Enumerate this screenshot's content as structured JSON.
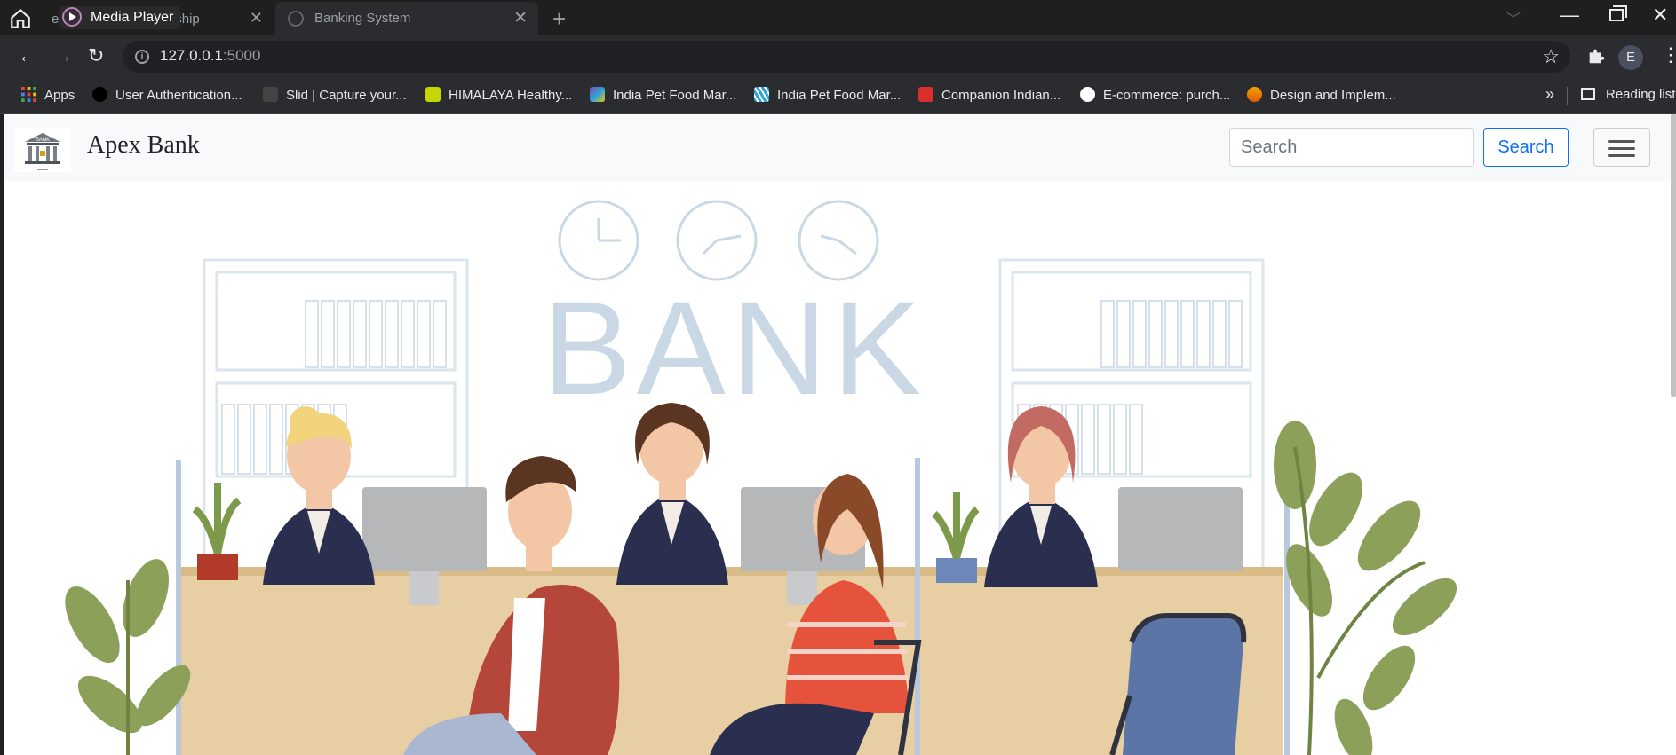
{
  "browser": {
    "tabs": [
      {
        "title": "Media Player",
        "background_title": "e...Tera.. SCP_internship",
        "close": "✕"
      },
      {
        "title": "Banking System",
        "close": "✕"
      }
    ],
    "new_tab": "+",
    "url_host": "127.0.0.1",
    "url_port": ":5000",
    "profile_initial": "E"
  },
  "bookmarks": [
    {
      "label": "Apps",
      "icon_color": "#ea4335"
    },
    {
      "label": "User Authentication...",
      "icon_color": "#000000"
    },
    {
      "label": "Slid | Capture your...",
      "icon_color": "#444444"
    },
    {
      "label": "HIMALAYA Healthy...",
      "icon_color": "#c6d600"
    },
    {
      "label": "India Pet Food Mar...",
      "icon_color": "#8e44ad"
    },
    {
      "label": "India Pet Food Mar...",
      "icon_color": "#2aa4d8"
    },
    {
      "label": "Companion Indian...",
      "icon_color": "#d9302b"
    },
    {
      "label": "E-commerce: purch...",
      "icon_color": "#111111"
    },
    {
      "label": "Design and Implem...",
      "icon_color": "#f0a500"
    }
  ],
  "reading_list": "Reading list",
  "site": {
    "brand": "Apex Bank",
    "logo_text": "BANK",
    "search_placeholder": "Search",
    "search_button": "Search"
  },
  "hero": {
    "sign": "BANK"
  },
  "colors": {
    "primary": "#0d6efd",
    "navbar_bg": "#f8f9fa",
    "chrome_bg": "#2b2c2f"
  }
}
